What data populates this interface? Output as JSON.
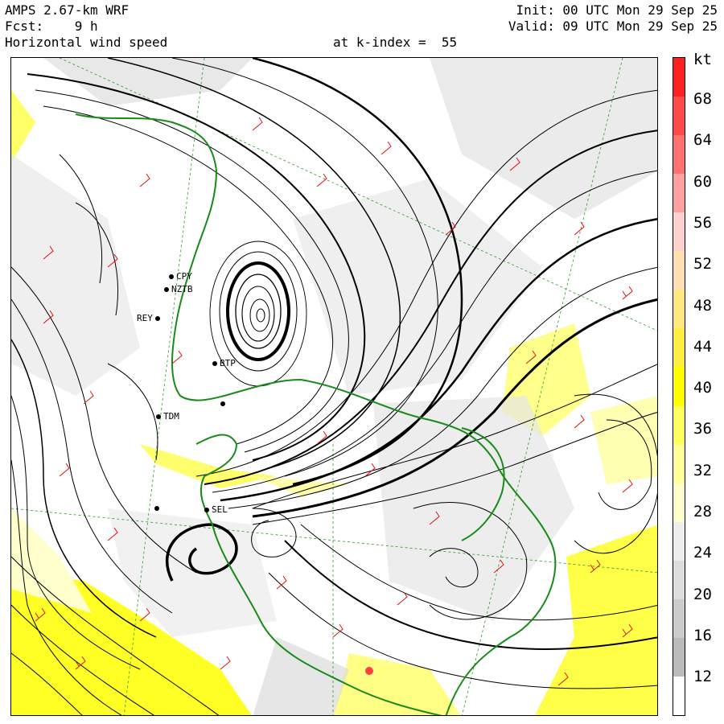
{
  "header": {
    "model": "AMPS 2.67-km WRF",
    "fcst": "Fcst:    9 h",
    "field": "Horizontal wind speed",
    "level": "at k-index =  55",
    "init": "Init: 00 UTC Mon 29 Sep 25",
    "valid": "Valid: 09 UTC Mon 29 Sep 25"
  },
  "colorbar": {
    "unit": "kt",
    "labels": [
      "68",
      "64",
      "60",
      "56",
      "52",
      "48",
      "44",
      "40",
      "36",
      "32",
      "28",
      "24",
      "20",
      "16",
      "12"
    ],
    "colors": [
      "#ff2020",
      "#ff4a4a",
      "#ff7070",
      "#ffa0a0",
      "#ffd0d0",
      "#ffe0b0",
      "#ffe880",
      "#ffee40",
      "#ffff00",
      "#ffff60",
      "#ffff99",
      "#ffffcc",
      "#eeeeee",
      "#dddddd",
      "#cccccc",
      "#bbbbbb",
      "#ffffff"
    ]
  },
  "stations": [
    {
      "name": "CPY"
    },
    {
      "name": "NZTB"
    },
    {
      "name": "REY"
    },
    {
      "name": "BTP"
    },
    {
      "name": "TDM"
    },
    {
      "name": "SEL"
    }
  ],
  "colors": {
    "coastline": "#1a8a1a",
    "barbs": "#e01010",
    "streamlines": "#000000",
    "grid": "#2a9a2a"
  }
}
